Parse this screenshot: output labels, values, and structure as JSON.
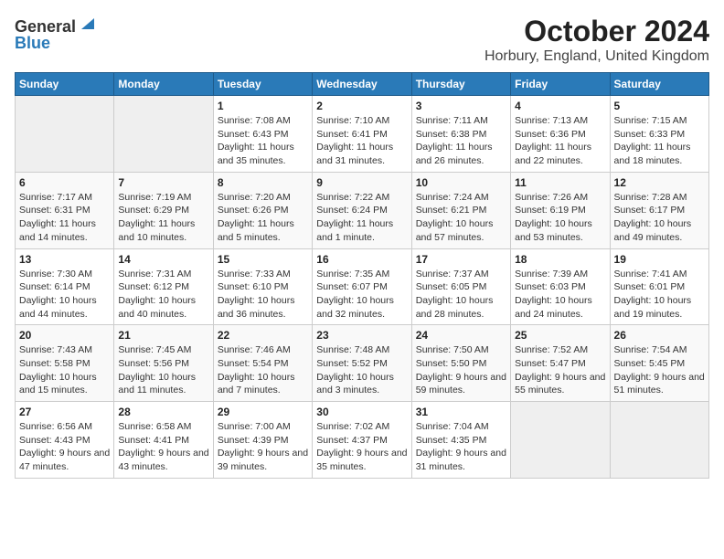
{
  "header": {
    "logo_general": "General",
    "logo_blue": "Blue",
    "month_title": "October 2024",
    "location": "Horbury, England, United Kingdom"
  },
  "weekdays": [
    "Sunday",
    "Monday",
    "Tuesday",
    "Wednesday",
    "Thursday",
    "Friday",
    "Saturday"
  ],
  "weeks": [
    [
      {
        "day": "",
        "content": ""
      },
      {
        "day": "",
        "content": ""
      },
      {
        "day": "1",
        "content": "Sunrise: 7:08 AM\nSunset: 6:43 PM\nDaylight: 11 hours and 35 minutes."
      },
      {
        "day": "2",
        "content": "Sunrise: 7:10 AM\nSunset: 6:41 PM\nDaylight: 11 hours and 31 minutes."
      },
      {
        "day": "3",
        "content": "Sunrise: 7:11 AM\nSunset: 6:38 PM\nDaylight: 11 hours and 26 minutes."
      },
      {
        "day": "4",
        "content": "Sunrise: 7:13 AM\nSunset: 6:36 PM\nDaylight: 11 hours and 22 minutes."
      },
      {
        "day": "5",
        "content": "Sunrise: 7:15 AM\nSunset: 6:33 PM\nDaylight: 11 hours and 18 minutes."
      }
    ],
    [
      {
        "day": "6",
        "content": "Sunrise: 7:17 AM\nSunset: 6:31 PM\nDaylight: 11 hours and 14 minutes."
      },
      {
        "day": "7",
        "content": "Sunrise: 7:19 AM\nSunset: 6:29 PM\nDaylight: 11 hours and 10 minutes."
      },
      {
        "day": "8",
        "content": "Sunrise: 7:20 AM\nSunset: 6:26 PM\nDaylight: 11 hours and 5 minutes."
      },
      {
        "day": "9",
        "content": "Sunrise: 7:22 AM\nSunset: 6:24 PM\nDaylight: 11 hours and 1 minute."
      },
      {
        "day": "10",
        "content": "Sunrise: 7:24 AM\nSunset: 6:21 PM\nDaylight: 10 hours and 57 minutes."
      },
      {
        "day": "11",
        "content": "Sunrise: 7:26 AM\nSunset: 6:19 PM\nDaylight: 10 hours and 53 minutes."
      },
      {
        "day": "12",
        "content": "Sunrise: 7:28 AM\nSunset: 6:17 PM\nDaylight: 10 hours and 49 minutes."
      }
    ],
    [
      {
        "day": "13",
        "content": "Sunrise: 7:30 AM\nSunset: 6:14 PM\nDaylight: 10 hours and 44 minutes."
      },
      {
        "day": "14",
        "content": "Sunrise: 7:31 AM\nSunset: 6:12 PM\nDaylight: 10 hours and 40 minutes."
      },
      {
        "day": "15",
        "content": "Sunrise: 7:33 AM\nSunset: 6:10 PM\nDaylight: 10 hours and 36 minutes."
      },
      {
        "day": "16",
        "content": "Sunrise: 7:35 AM\nSunset: 6:07 PM\nDaylight: 10 hours and 32 minutes."
      },
      {
        "day": "17",
        "content": "Sunrise: 7:37 AM\nSunset: 6:05 PM\nDaylight: 10 hours and 28 minutes."
      },
      {
        "day": "18",
        "content": "Sunrise: 7:39 AM\nSunset: 6:03 PM\nDaylight: 10 hours and 24 minutes."
      },
      {
        "day": "19",
        "content": "Sunrise: 7:41 AM\nSunset: 6:01 PM\nDaylight: 10 hours and 19 minutes."
      }
    ],
    [
      {
        "day": "20",
        "content": "Sunrise: 7:43 AM\nSunset: 5:58 PM\nDaylight: 10 hours and 15 minutes."
      },
      {
        "day": "21",
        "content": "Sunrise: 7:45 AM\nSunset: 5:56 PM\nDaylight: 10 hours and 11 minutes."
      },
      {
        "day": "22",
        "content": "Sunrise: 7:46 AM\nSunset: 5:54 PM\nDaylight: 10 hours and 7 minutes."
      },
      {
        "day": "23",
        "content": "Sunrise: 7:48 AM\nSunset: 5:52 PM\nDaylight: 10 hours and 3 minutes."
      },
      {
        "day": "24",
        "content": "Sunrise: 7:50 AM\nSunset: 5:50 PM\nDaylight: 9 hours and 59 minutes."
      },
      {
        "day": "25",
        "content": "Sunrise: 7:52 AM\nSunset: 5:47 PM\nDaylight: 9 hours and 55 minutes."
      },
      {
        "day": "26",
        "content": "Sunrise: 7:54 AM\nSunset: 5:45 PM\nDaylight: 9 hours and 51 minutes."
      }
    ],
    [
      {
        "day": "27",
        "content": "Sunrise: 6:56 AM\nSunset: 4:43 PM\nDaylight: 9 hours and 47 minutes."
      },
      {
        "day": "28",
        "content": "Sunrise: 6:58 AM\nSunset: 4:41 PM\nDaylight: 9 hours and 43 minutes."
      },
      {
        "day": "29",
        "content": "Sunrise: 7:00 AM\nSunset: 4:39 PM\nDaylight: 9 hours and 39 minutes."
      },
      {
        "day": "30",
        "content": "Sunrise: 7:02 AM\nSunset: 4:37 PM\nDaylight: 9 hours and 35 minutes."
      },
      {
        "day": "31",
        "content": "Sunrise: 7:04 AM\nSunset: 4:35 PM\nDaylight: 9 hours and 31 minutes."
      },
      {
        "day": "",
        "content": ""
      },
      {
        "day": "",
        "content": ""
      }
    ]
  ]
}
